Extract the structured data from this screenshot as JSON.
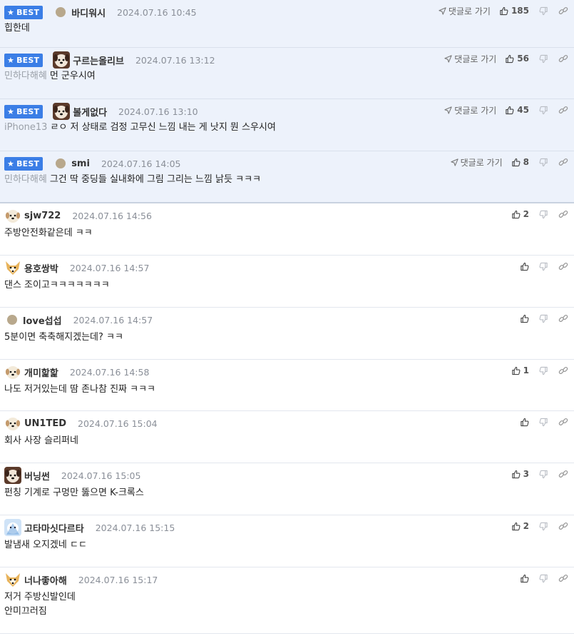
{
  "labels": {
    "best": "BEST",
    "reply_link": "댓글로 가기"
  },
  "colors": {
    "best_badge": "#3b7ee6",
    "best_row_bg": "#edf2fb"
  },
  "comments": [
    {
      "best": true,
      "avatar": "dot-avatar",
      "nick": "바디워시",
      "date": "2024.07.16 10:45",
      "device": "",
      "text": "힙한데",
      "likes": "185"
    },
    {
      "best": true,
      "avatar": "dog-avatar",
      "nick": "구르는올리브",
      "date": "2024.07.16 13:12",
      "device": "민하다해혜",
      "text": "먼 군우시여",
      "likes": "56"
    },
    {
      "best": true,
      "avatar": "dog-avatar",
      "nick": "볼게없다",
      "date": "2024.07.16 13:10",
      "device": "iPhone13",
      "text": "ㄹㅇ 저 상태로 검정 고무신 느낌 내는 게 낫지 뭔 스우시여",
      "likes": "45"
    },
    {
      "best": true,
      "avatar": "dot-avatar",
      "nick": "smi",
      "date": "2024.07.16 14:05",
      "device": "민하다해혜",
      "text": "그건 딱 중딩들 실내화에 그림 그리는 느낌 낡듯 ㅋㅋㅋ",
      "likes": "8"
    },
    {
      "best": false,
      "avatar": "puppy-avatar",
      "nick": "sjw722",
      "date": "2024.07.16 14:56",
      "device": "",
      "text": "주방안전화같은데 ㅋㅋ",
      "likes": "2"
    },
    {
      "best": false,
      "avatar": "fox-avatar",
      "nick": "용호쌍박",
      "date": "2024.07.16 14:57",
      "device": "",
      "text": "댄스 조이고ㅋㅋㅋㅋㅋㅋㅋ",
      "likes": ""
    },
    {
      "best": false,
      "avatar": "dot-avatar",
      "nick": "love섭섭",
      "date": "2024.07.16 14:57",
      "device": "",
      "text": "5분이면 축축해지겠는데? ㅋㅋ",
      "likes": ""
    },
    {
      "best": false,
      "avatar": "puppy-avatar",
      "nick": "개미핥핥",
      "date": "2024.07.16 14:58",
      "device": "",
      "text": "나도 저거있는데 땀 존나참 진짜 ㅋㅋㅋ",
      "likes": "1"
    },
    {
      "best": false,
      "avatar": "puppy-avatar",
      "nick": "UN1TED",
      "date": "2024.07.16 15:04",
      "device": "",
      "text": "회사 사장 슬리퍼네",
      "likes": ""
    },
    {
      "best": false,
      "avatar": "dog-avatar",
      "nick": "버닝썬",
      "date": "2024.07.16 15:05",
      "device": "",
      "text": "펀칭 기계로 구멍만 뚫으면 K-크록스",
      "likes": "3"
    },
    {
      "best": false,
      "avatar": "blue-avatar",
      "nick": "고타마싯다르타",
      "date": "2024.07.16 15:15",
      "device": "",
      "text": "발냄새 오지겠네 ㄷㄷ",
      "likes": "2"
    },
    {
      "best": false,
      "avatar": "fox-avatar",
      "nick": "너나좋아해",
      "date": "2024.07.16 15:17",
      "device": "",
      "text": "저거 주방신발인데\n안미끄러짐",
      "likes": ""
    }
  ]
}
